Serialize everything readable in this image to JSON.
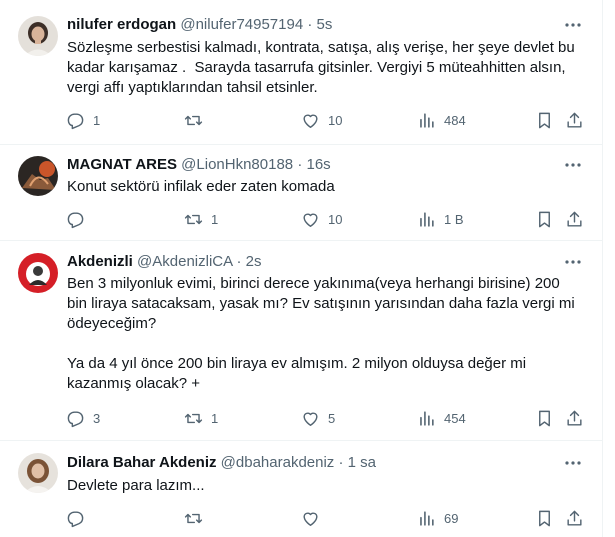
{
  "tweets": [
    {
      "name": "nilufer erdogan",
      "handle": "@nilufer74957194",
      "dot": "·",
      "time": "5s",
      "text": "Sözleşme serbestisi kalmadı, kontrata, satışa, alış verişe, her şeye devlet bu kadar karışamaz .  Sarayda tasarrufa gitsinler. Vergiyi 5 müteahhitten alsın, vergi affı yaptıklarından tahsil etsinler.",
      "replies": "1",
      "retweets": "",
      "likes": "10",
      "views": "484"
    },
    {
      "name": "MAGNAT ARES",
      "handle": "@LionHkn80188",
      "dot": "·",
      "time": "16s",
      "text": "Konut sektörü infilak eder zaten komada",
      "replies": "",
      "retweets": "1",
      "likes": "10",
      "views": "1 B"
    },
    {
      "name": "Akdenizli",
      "handle": "@AkdenizliCA",
      "dot": "·",
      "time": "2s",
      "text": "Ben 3 milyonluk evimi, birinci derece yakınıma(veya herhangi birisine) 200 bin liraya satacaksam, yasak mı? Ev satışının yarısından daha fazla vergi mi ödeyeceğim?\n\nYa da 4 yıl önce 200 bin liraya ev almışım. 2 milyon olduysa değer mi kazanmış olacak? +",
      "replies": "3",
      "retweets": "1",
      "likes": "5",
      "views": "454"
    },
    {
      "name": "Dilara Bahar Akdeniz",
      "handle": "@dbaharakdeniz",
      "dot": "·",
      "time": "1 sa",
      "text": "Devlete para lazım...",
      "replies": "",
      "retweets": "",
      "likes": "",
      "views": "69"
    }
  ],
  "icons": {
    "reply": "reply-icon",
    "retweet": "retweet-icon",
    "like": "heart-icon",
    "views": "views-icon",
    "bookmark": "bookmark-icon",
    "share": "share-icon",
    "more": "more-icon"
  },
  "colors": {
    "text": "#0f1419",
    "secondary": "#536471",
    "divider": "#eff3f4"
  }
}
